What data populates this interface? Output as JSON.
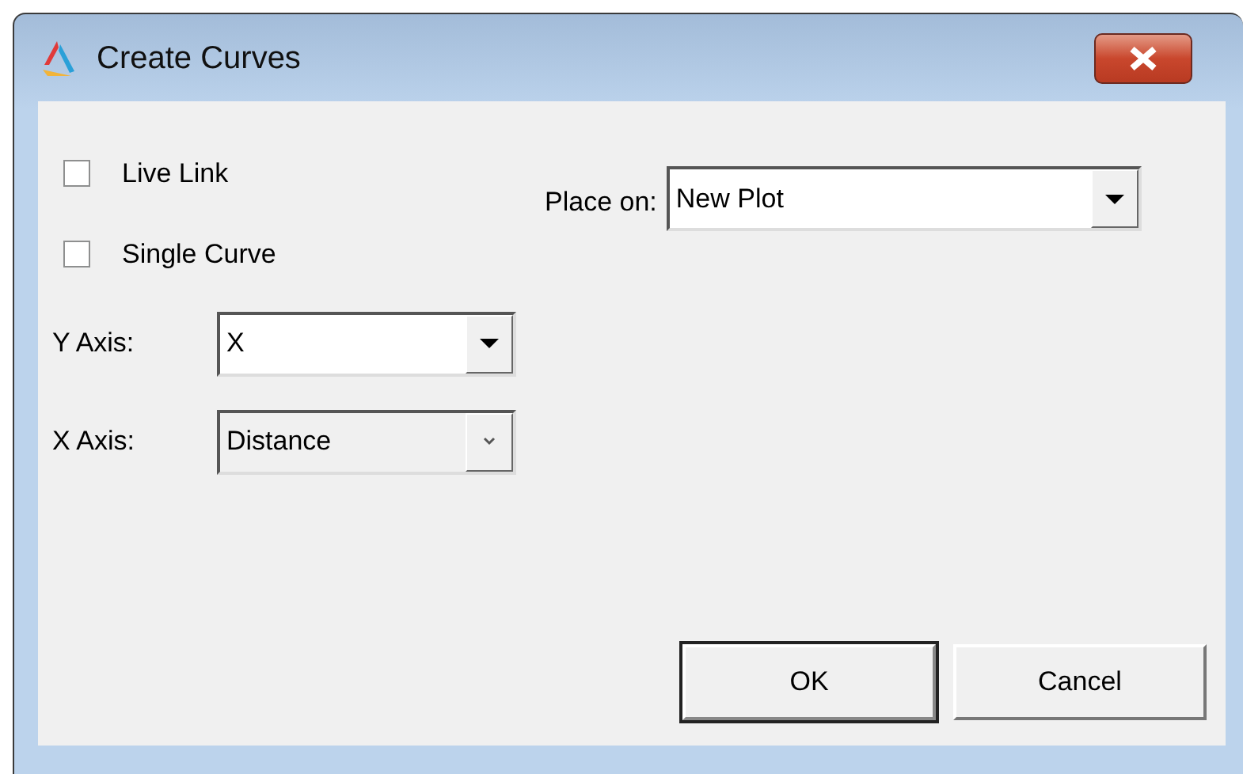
{
  "window": {
    "title": "Create Curves"
  },
  "options": [
    {
      "label": "Live Link",
      "checked": false
    },
    {
      "label": "Single Curve",
      "checked": false
    }
  ],
  "axes": [
    {
      "label": "Y Axis:",
      "value": "X",
      "disabled": false
    },
    {
      "label": "X Axis:",
      "value": "Distance",
      "disabled": true
    }
  ],
  "place_on": {
    "label": "Place on:",
    "value": "New Plot",
    "disabled": false
  },
  "buttons": [
    {
      "label": "OK",
      "default": true
    },
    {
      "label": "Cancel",
      "default": false
    }
  ]
}
